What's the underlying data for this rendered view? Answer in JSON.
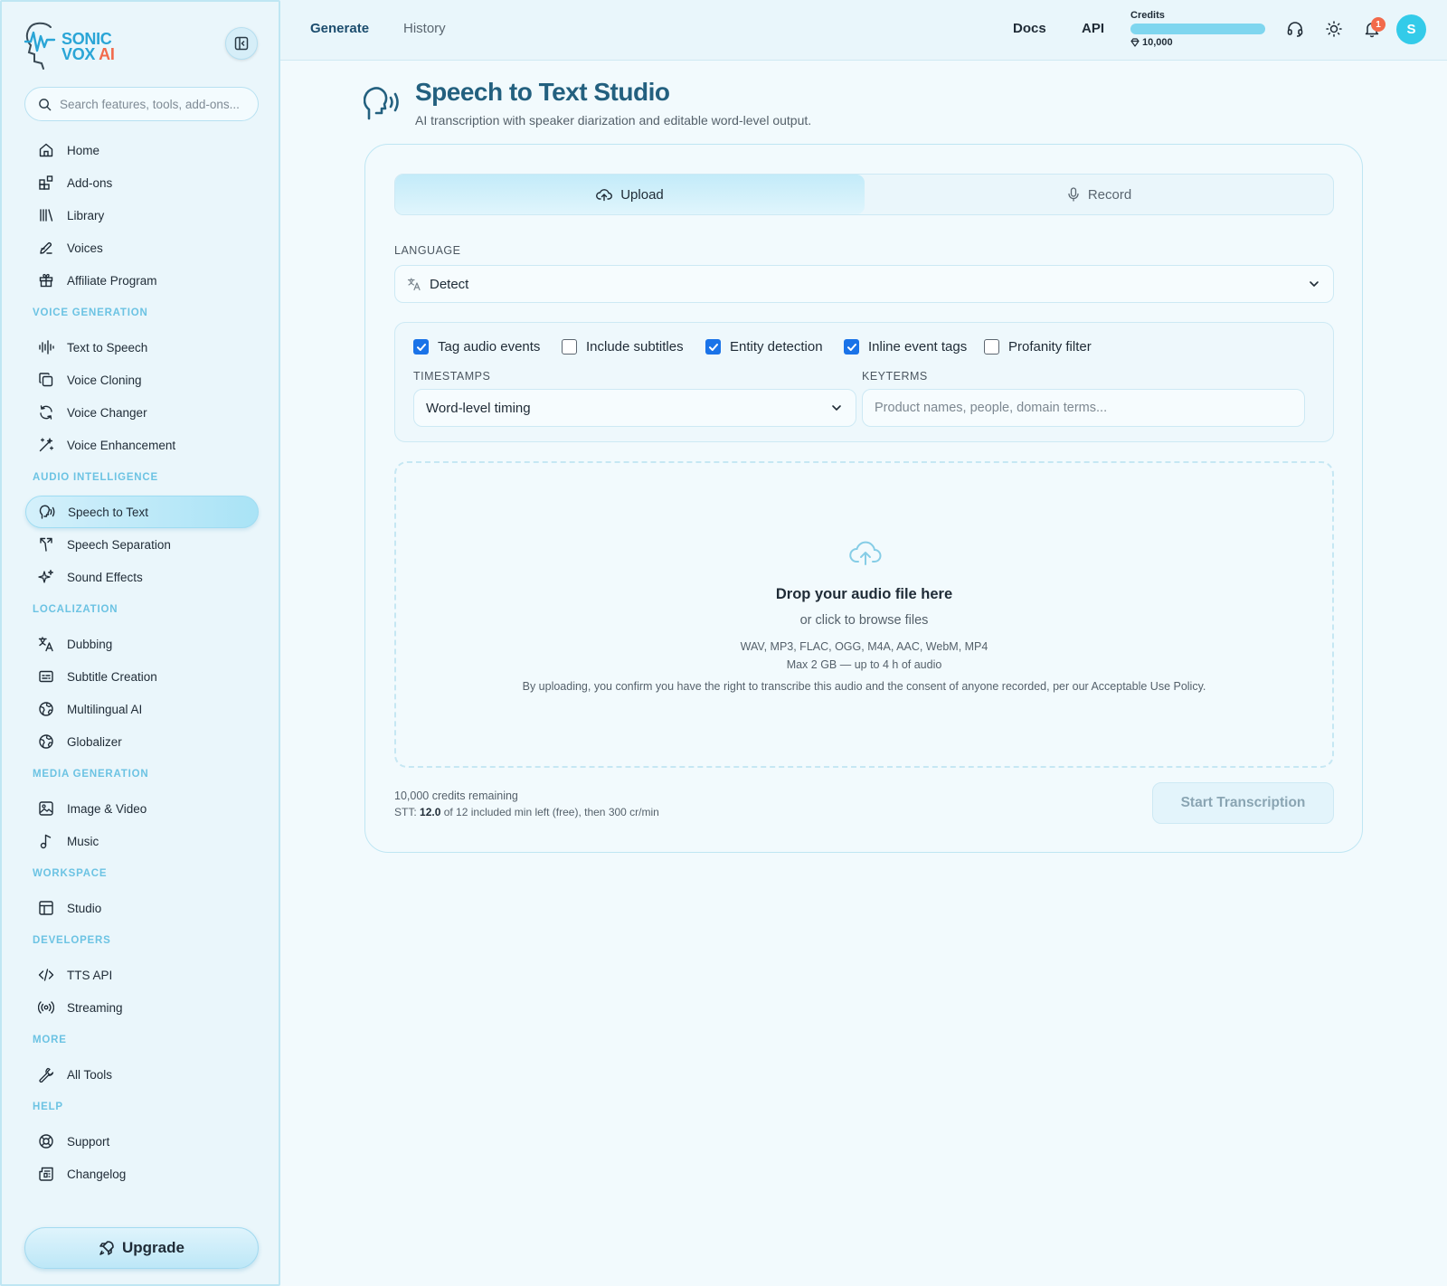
{
  "brand": {
    "line1": "SONIC",
    "line2": "VOX",
    "line2_suffix": "AI"
  },
  "search": {
    "placeholder": "Search features, tools, add-ons..."
  },
  "nav": {
    "top_items": [
      {
        "label": "Home",
        "icon": "home-icon"
      },
      {
        "label": "Add-ons",
        "icon": "puzzle-icon"
      },
      {
        "label": "Library",
        "icon": "library-icon"
      },
      {
        "label": "Voices",
        "icon": "pen-icon"
      },
      {
        "label": "Affiliate Program",
        "icon": "gift-icon"
      }
    ],
    "sections": [
      {
        "title": "VOICE GENERATION",
        "items": [
          {
            "label": "Text to Speech",
            "icon": "waveform-icon"
          },
          {
            "label": "Voice Cloning",
            "icon": "copy-icon"
          },
          {
            "label": "Voice Changer",
            "icon": "refresh-icon"
          },
          {
            "label": "Voice Enhancement",
            "icon": "magic-wand-icon"
          }
        ]
      },
      {
        "title": "AUDIO INTELLIGENCE",
        "items": [
          {
            "label": "Speech to Text",
            "icon": "speech-icon",
            "active": true
          },
          {
            "label": "Speech Separation",
            "icon": "split-icon"
          },
          {
            "label": "Sound Effects",
            "icon": "sparkles-icon"
          }
        ]
      },
      {
        "title": "LOCALIZATION",
        "items": [
          {
            "label": "Dubbing",
            "icon": "translate-icon"
          },
          {
            "label": "Subtitle Creation",
            "icon": "captions-icon"
          },
          {
            "label": "Multilingual AI",
            "icon": "globe-icon"
          },
          {
            "label": "Globalizer",
            "icon": "globe-icon"
          }
        ]
      },
      {
        "title": "MEDIA GENERATION",
        "items": [
          {
            "label": "Image & Video",
            "icon": "image-icon"
          },
          {
            "label": "Music",
            "icon": "music-note-icon"
          }
        ]
      },
      {
        "title": "WORKSPACE",
        "items": [
          {
            "label": "Studio",
            "icon": "layout-icon"
          }
        ]
      },
      {
        "title": "DEVELOPERS",
        "items": [
          {
            "label": "TTS API",
            "icon": "code-icon"
          },
          {
            "label": "Streaming",
            "icon": "broadcast-icon"
          }
        ]
      },
      {
        "title": "MORE",
        "items": [
          {
            "label": "All Tools",
            "icon": "wrench-icon"
          }
        ]
      },
      {
        "title": "HELP",
        "items": [
          {
            "label": "Support",
            "icon": "lifebuoy-icon"
          },
          {
            "label": "Changelog",
            "icon": "newspaper-icon"
          }
        ]
      }
    ]
  },
  "upgrade": {
    "label": "Upgrade"
  },
  "topbar": {
    "tabs": [
      "Generate",
      "History"
    ],
    "links": [
      "Docs",
      "API"
    ],
    "credits_label": "Credits",
    "credits_value": "10,000",
    "credits_fill_fraction": 1.0,
    "notification_count": "1",
    "avatar_initial": "S"
  },
  "page": {
    "title": "Speech to Text Studio",
    "subtitle": "AI transcription with speaker diarization and editable word-level output."
  },
  "mode_tabs": {
    "upload": "Upload",
    "record": "Record",
    "selected": "Upload"
  },
  "language": {
    "label": "LANGUAGE",
    "value": "Detect"
  },
  "options": [
    {
      "label": "Tag audio events",
      "checked": true
    },
    {
      "label": "Include subtitles",
      "checked": false
    },
    {
      "label": "Entity detection",
      "checked": true
    },
    {
      "label": "Inline event tags",
      "checked": true
    },
    {
      "label": "Profanity filter",
      "checked": false
    }
  ],
  "timestamps": {
    "label": "TIMESTAMPS",
    "value": "Word-level timing"
  },
  "keyterms": {
    "label": "KEYTERMS",
    "placeholder": "Product names, people, domain terms..."
  },
  "dropzone": {
    "title": "Drop your audio file here",
    "subtitle": "or click to browse files",
    "formats": "WAV, MP3, FLAC, OGG, M4A, AAC, WebM, MP4",
    "limits": "Max 2 GB — up to 4 h of audio",
    "consent": "By uploading, you confirm you have the right to transcribe this audio and the consent of anyone recorded, per our Acceptable Use Policy."
  },
  "footer": {
    "credits_remaining": "10,000 credits remaining",
    "stt_prefix": "STT:",
    "stt_minutes": "12.0",
    "stt_suffix": "of 12 included min left (free), then 300 cr/min",
    "start_label": "Start Transcription"
  },
  "colors": {
    "accent": "#33cbe9",
    "active_checkbox": "#1a73e8",
    "brand_orange": "#f26a4b",
    "title": "#23607f",
    "section": "#6cc3e3"
  }
}
